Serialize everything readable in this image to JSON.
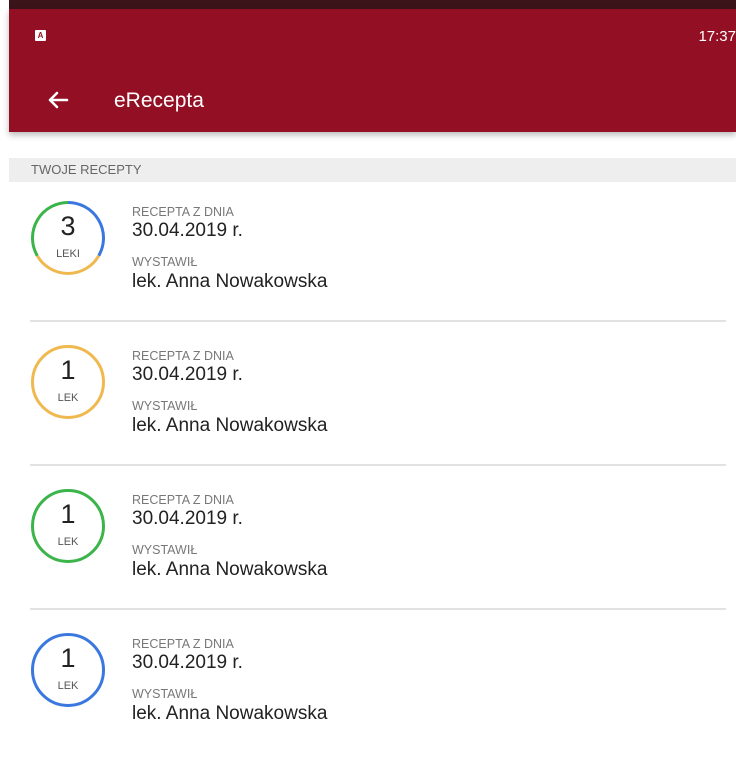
{
  "status_bar": {
    "badge": "A",
    "time": "17:37"
  },
  "app_bar": {
    "title": "eRecepta",
    "back_icon": "arrow-left-icon"
  },
  "section": {
    "title": "TWOJE RECEPTY"
  },
  "labels": {
    "date_label": "RECEPTA Z DNIA",
    "issuer_label": "WYSTAWIŁ"
  },
  "colors": {
    "brand": "#930f23",
    "ring_blue": "#3a78e0",
    "ring_green": "#3bb54a",
    "ring_yellow": "#efb950"
  },
  "prescriptions": [
    {
      "count": "3",
      "unit": "LEKI",
      "date": "30.04.2019 r.",
      "issuer": "lek. Anna Nowakowska",
      "ring": [
        "ring_blue",
        "ring_yellow",
        "ring_green"
      ]
    },
    {
      "count": "1",
      "unit": "LEK",
      "date": "30.04.2019 r.",
      "issuer": "lek. Anna Nowakowska",
      "ring": [
        "ring_yellow"
      ]
    },
    {
      "count": "1",
      "unit": "LEK",
      "date": "30.04.2019 r.",
      "issuer": "lek. Anna Nowakowska",
      "ring": [
        "ring_green"
      ]
    },
    {
      "count": "1",
      "unit": "LEK",
      "date": "30.04.2019 r.",
      "issuer": "lek. Anna Nowakowska",
      "ring": [
        "ring_blue"
      ]
    }
  ]
}
